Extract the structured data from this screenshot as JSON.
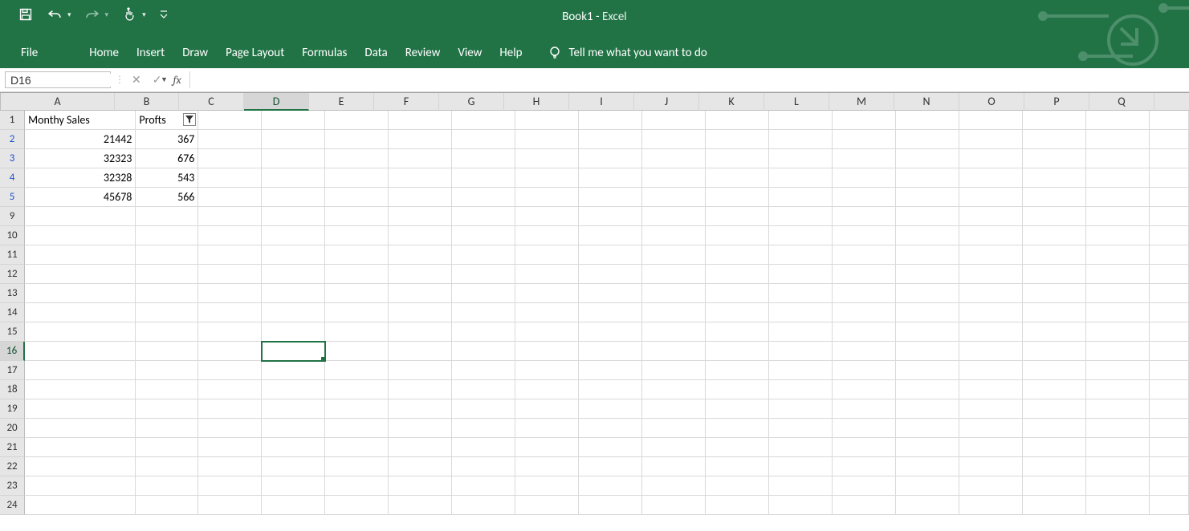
{
  "app": {
    "title_main": "Book1",
    "title_sep": "  -  ",
    "title_sub": "Excel"
  },
  "tabs": [
    "File",
    "Home",
    "Insert",
    "Draw",
    "Page Layout",
    "Formulas",
    "Data",
    "Review",
    "View",
    "Help"
  ],
  "tellme": "Tell me what you want to do",
  "namebox": "D16",
  "fx_label": "fx",
  "formula_value": "",
  "columns": [
    "A",
    "B",
    "C",
    "D",
    "E",
    "F",
    "G",
    "H",
    "I",
    "J",
    "K",
    "L",
    "M",
    "N",
    "O",
    "P",
    "Q"
  ],
  "active_col": "D",
  "row_numbers": [
    1,
    2,
    3,
    4,
    5,
    9,
    10,
    11,
    12,
    13,
    14,
    15,
    16,
    17,
    18,
    19,
    20,
    21,
    22,
    23,
    24
  ],
  "filtered_rows": [
    2,
    3,
    4,
    5
  ],
  "active_row": 16,
  "sheet": {
    "headers": {
      "A": "Monthy Sales",
      "B": "Profts"
    },
    "data_rows": [
      {
        "row": 2,
        "A": "21442",
        "B": "367"
      },
      {
        "row": 3,
        "A": "32323",
        "B": "676"
      },
      {
        "row": 4,
        "A": "32328",
        "B": "543"
      },
      {
        "row": 5,
        "A": "45678",
        "B": "566"
      }
    ]
  }
}
